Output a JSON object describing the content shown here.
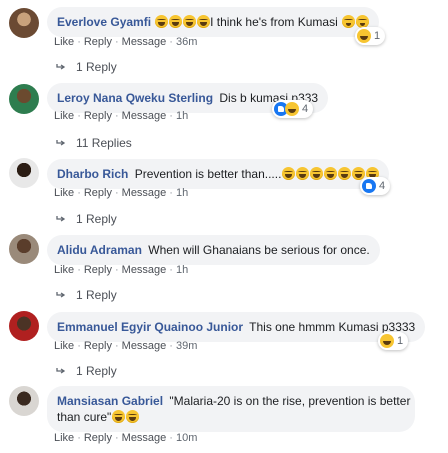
{
  "meta_actions": {
    "like": "Like",
    "reply": "Reply",
    "message": "Message"
  },
  "comments": [
    {
      "author": "Everlove Gyamfi",
      "text": "I think he's from Kumasi",
      "time": "36m",
      "reaction_count": "1",
      "reaction_icons": [
        "haha-icon"
      ],
      "replies_label": "1 Reply"
    },
    {
      "author": "Leroy Nana Qweku Sterling",
      "text": "Dis b kumasi p333",
      "time": "1h",
      "reaction_count": "4",
      "reaction_icons": [
        "like-icon",
        "haha-icon"
      ],
      "replies_label": "11 Replies"
    },
    {
      "author": "Dharbo Rich",
      "text": "Prevention is better than.....",
      "time": "1h",
      "reaction_count": "4",
      "reaction_icons": [
        "like-icon"
      ],
      "replies_label": "1 Reply"
    },
    {
      "author": "Alidu Adraman",
      "text": "When will Ghanaians be serious for once.",
      "time": "1h",
      "replies_label": "1 Reply"
    },
    {
      "author": "Emmanuel Egyir Quainoo Junior",
      "text": "This one hmmm Kumasi p3333",
      "time": "39m",
      "reaction_count": "1",
      "reaction_icons": [
        "haha-icon"
      ],
      "replies_label": "1 Reply"
    },
    {
      "author": "Mansiasan Gabriel",
      "text_line1": "\"Malaria-20 is on the rise, prevention is better",
      "text_line2": "than cure\"",
      "time": "10m"
    }
  ],
  "colors": {
    "author": "#385898",
    "bubble": "#f2f3f5",
    "meta": "#606770"
  }
}
